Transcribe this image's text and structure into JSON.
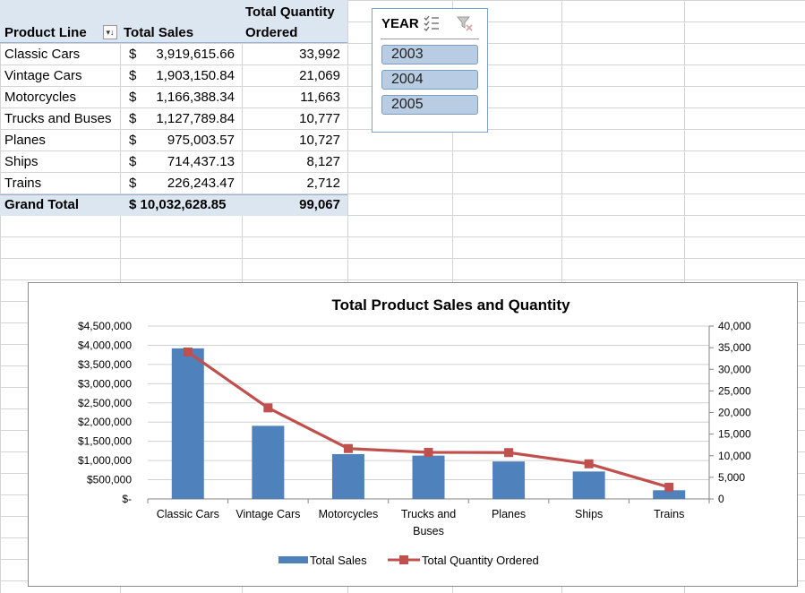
{
  "pivot": {
    "headers": {
      "product_line": "Product Line",
      "total_sales": "Total Sales",
      "total_quantity_line1": "Total Quantity",
      "total_quantity_line2": "Ordered"
    },
    "rows": [
      {
        "product": "Classic Cars",
        "currency": "$",
        "sales": "3,919,615.66",
        "qty": "33,992"
      },
      {
        "product": "Vintage Cars",
        "currency": "$",
        "sales": "1,903,150.84",
        "qty": "21,069"
      },
      {
        "product": "Motorcycles",
        "currency": "$",
        "sales": "1,166,388.34",
        "qty": "11,663"
      },
      {
        "product": "Trucks and Buses",
        "currency": "$",
        "sales": "1,127,789.84",
        "qty": "10,777"
      },
      {
        "product": "Planes",
        "currency": "$",
        "sales": "975,003.57",
        "qty": "10,727"
      },
      {
        "product": "Ships",
        "currency": "$",
        "sales": "714,437.13",
        "qty": "8,127"
      },
      {
        "product": "Trains",
        "currency": "$",
        "sales": "226,243.47",
        "qty": "2,712"
      }
    ],
    "grand_total": {
      "label": "Grand Total",
      "sales": "$ 10,032,628.85",
      "qty": "99,067"
    }
  },
  "slicer": {
    "title": "YEAR",
    "items": [
      "2003",
      "2004",
      "2005"
    ]
  },
  "colors": {
    "bar": "#4f81bd",
    "line": "#c0504d",
    "header_band": "#dce6f1",
    "slicer_item": "#b8cce4"
  },
  "chart_data": {
    "type": "bar",
    "title": "Total Product Sales and Quantity",
    "categories": [
      "Classic Cars",
      "Vintage Cars",
      "Motorcycles",
      "Trucks and Buses",
      "Planes",
      "Ships",
      "Trains"
    ],
    "series": [
      {
        "name": "Total Sales",
        "type": "bar",
        "axis": "left",
        "values": [
          3919615.66,
          1903150.84,
          1166388.34,
          1127789.84,
          975003.57,
          714437.13,
          226243.47
        ]
      },
      {
        "name": "Total Quantity Ordered",
        "type": "line",
        "axis": "right",
        "values": [
          33992,
          21069,
          11663,
          10777,
          10727,
          8127,
          2712
        ]
      }
    ],
    "y_left": {
      "ylim": [
        0,
        4500000
      ],
      "tick_labels": [
        "$-",
        "$500,000",
        "$1,000,000",
        "$1,500,000",
        "$2,000,000",
        "$2,500,000",
        "$3,000,000",
        "$3,500,000",
        "$4,000,000",
        "$4,500,000"
      ]
    },
    "y_right": {
      "ylim": [
        0,
        40000
      ],
      "tick_labels": [
        "0",
        "5,000",
        "10,000",
        "15,000",
        "20,000",
        "25,000",
        "30,000",
        "35,000",
        "40,000"
      ]
    },
    "category_labels": [
      [
        "Classic Cars"
      ],
      [
        "Vintage Cars"
      ],
      [
        "Motorcycles"
      ],
      [
        "Trucks and",
        "Buses"
      ],
      [
        "Planes"
      ],
      [
        "Ships"
      ],
      [
        "Trains"
      ]
    ],
    "grid": true,
    "legend_position": "bottom"
  }
}
